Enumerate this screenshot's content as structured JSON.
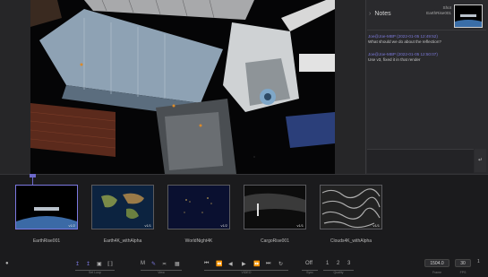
{
  "notes": {
    "title": "Notes",
    "shot_label": "Shot",
    "shot_name": "EarthRise001",
    "entries": [
      {
        "meta": "Joe@Joe-MBP (2022-01-05 12:49:52)",
        "text": "What should we do about the reflection?"
      },
      {
        "meta": "Joe@Joe-MBP (2022-01-05 12:50:07)",
        "text": "Use v3, fixed it in that render"
      }
    ],
    "send_icon": "return-icon"
  },
  "clips": [
    {
      "name": "EarthRise001",
      "badge": "v1/2"
    },
    {
      "name": "Earth4K_withAlpha",
      "badge": "v1/1"
    },
    {
      "name": "WorldNight4K",
      "badge": "v1/2"
    },
    {
      "name": "CargoRise001",
      "badge": "v1/1"
    },
    {
      "name": "Clouds4K_withAlpha",
      "badge": "v1/1"
    }
  ],
  "controls": {
    "groups": {
      "set_loop": "Set Loop",
      "view": "View",
      "video": "VIDEO",
      "sync": "Sync",
      "quality": "Quality",
      "frame": "Frame",
      "fps": "FPS"
    },
    "sync_value": "Off",
    "quality_options": [
      "1",
      "2",
      "3"
    ],
    "frame_value": "1504.0",
    "fps_value": "30",
    "extra_right": "1"
  },
  "colors": {
    "accent": "#7c78e0",
    "background": "#1f1f21",
    "panel": "#2a2a2d"
  }
}
